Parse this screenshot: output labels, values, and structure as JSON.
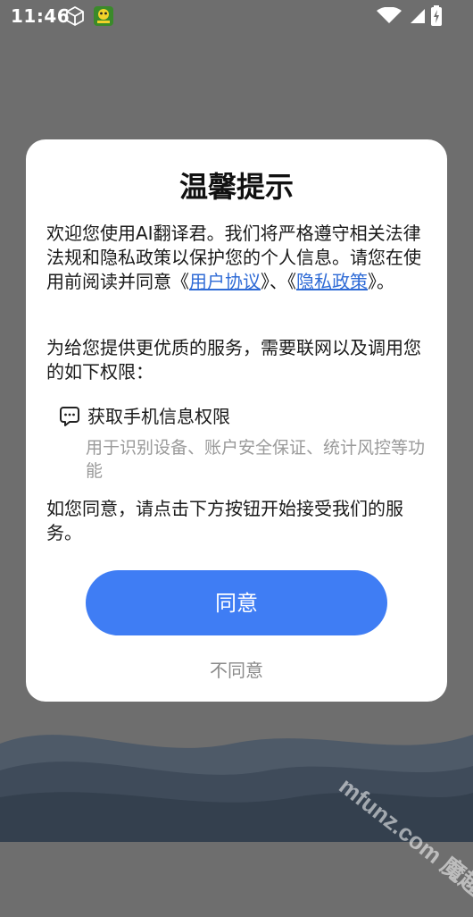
{
  "status_bar": {
    "time": "11:46",
    "icons": [
      "cube-icon",
      "app-notification-icon",
      "wifi-icon",
      "cellular-signal-icon",
      "battery-charging-icon"
    ]
  },
  "dialog": {
    "title": "温馨提示",
    "intro_text_1": "欢迎您使用AI翻译君。我们将严格遵守相关法律法规和隐私政策以保护您的个人信息。请您在使用前阅读并同意《",
    "user_agreement_link": "用户协议",
    "intro_text_2": "》、《",
    "privacy_policy_link": "隐私政策",
    "intro_text_3": "》。",
    "permission_intro": "为给您提供更优质的服务，需要联网以及调用您的如下权限：",
    "permission": {
      "icon": "chat-bubble-icon",
      "title": "获取手机信息权限",
      "description": "用于识别设备、账户安全保证、统计风控等功能"
    },
    "consent_text": "如您同意，请点击下方按钮开始接受我们的服务。",
    "agree_label": "同意",
    "disagree_label": "不同意"
  },
  "watermark": "mfunz.com 魔趣网",
  "colors": {
    "accent": "#3f7df4",
    "link": "#2f6bd6",
    "overlay": "#6e6e6e",
    "muted_text": "#9a9a9a"
  }
}
